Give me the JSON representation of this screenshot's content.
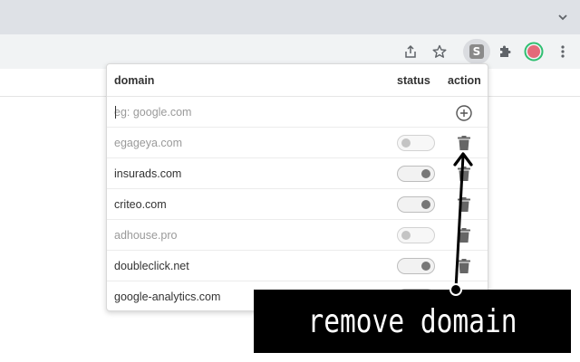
{
  "browser": {
    "tab_chevron_icon": "chevron-down-icon",
    "toolbar_icons": [
      "share-icon",
      "star-icon",
      "extension-s-icon",
      "puzzle-icon",
      "profile-avatar-icon",
      "more-vertical-icon"
    ],
    "extension_letter": "S",
    "avatar_color": "#e46a7a",
    "avatar_ring": "#2fbf71"
  },
  "popup": {
    "headers": {
      "domain": "domain",
      "status": "status",
      "action": "action"
    },
    "input": {
      "placeholder": "eg: google.com",
      "value": ""
    },
    "rows": [
      {
        "domain": "egageya.com",
        "enabled": false
      },
      {
        "domain": "insurads.com",
        "enabled": true
      },
      {
        "domain": "criteo.com",
        "enabled": true
      },
      {
        "domain": "adhouse.pro",
        "enabled": false
      },
      {
        "domain": "doubleclick.net",
        "enabled": true
      },
      {
        "domain": "google-analytics.com",
        "enabled": true
      }
    ]
  },
  "callout": {
    "text": "remove domain"
  }
}
